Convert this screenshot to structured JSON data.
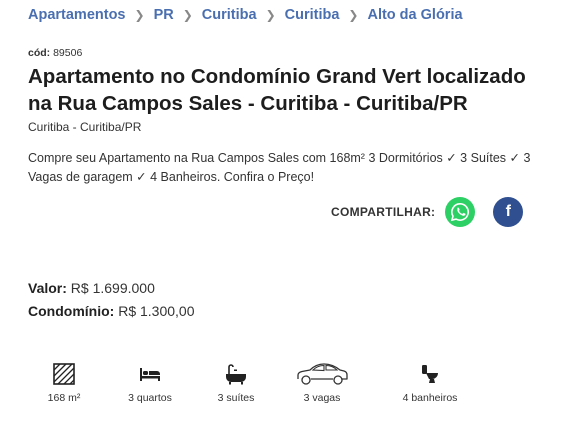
{
  "breadcrumb": [
    "Apartamentos",
    "PR",
    "Curitiba",
    "Curitiba",
    "Alto da Glória"
  ],
  "code": {
    "label": "cód:",
    "value": "89506"
  },
  "title": "Apartamento no Condomínio Grand Vert localizado na Rua Campos Sales - Curitiba - Curitiba/PR",
  "location": "Curitiba - Curitiba/PR",
  "description": "Compre seu Apartamento na Rua Campos Sales com 168m² 3 Dormitórios ✓ 3 Suítes ✓ 3 Vagas de garagem ✓ 4 Banheiros. Confira o Preço!",
  "share": {
    "label": "COMPARTILHAR:",
    "whatsapp_icon": "whatsapp-icon",
    "facebook_icon": "facebook-icon",
    "facebook_glyph": "f"
  },
  "prices": {
    "valor_label": "Valor:",
    "valor": "R$ 1.699.000",
    "condominio_label": "Condomínio:",
    "condominio": "R$ 1.300,00"
  },
  "features": [
    {
      "icon": "area-icon",
      "label": "168 m²"
    },
    {
      "icon": "bed-icon",
      "label": "3 quartos"
    },
    {
      "icon": "bathtub-icon",
      "label": "3 suítes"
    },
    {
      "icon": "car-icon",
      "label": "3 vagas"
    },
    {
      "icon": "toilet-icon",
      "label": "4 banheiros"
    }
  ],
  "colors": {
    "link": "#4a6fb0",
    "whatsapp": "#2dd064",
    "facebook": "#2f4f91"
  }
}
